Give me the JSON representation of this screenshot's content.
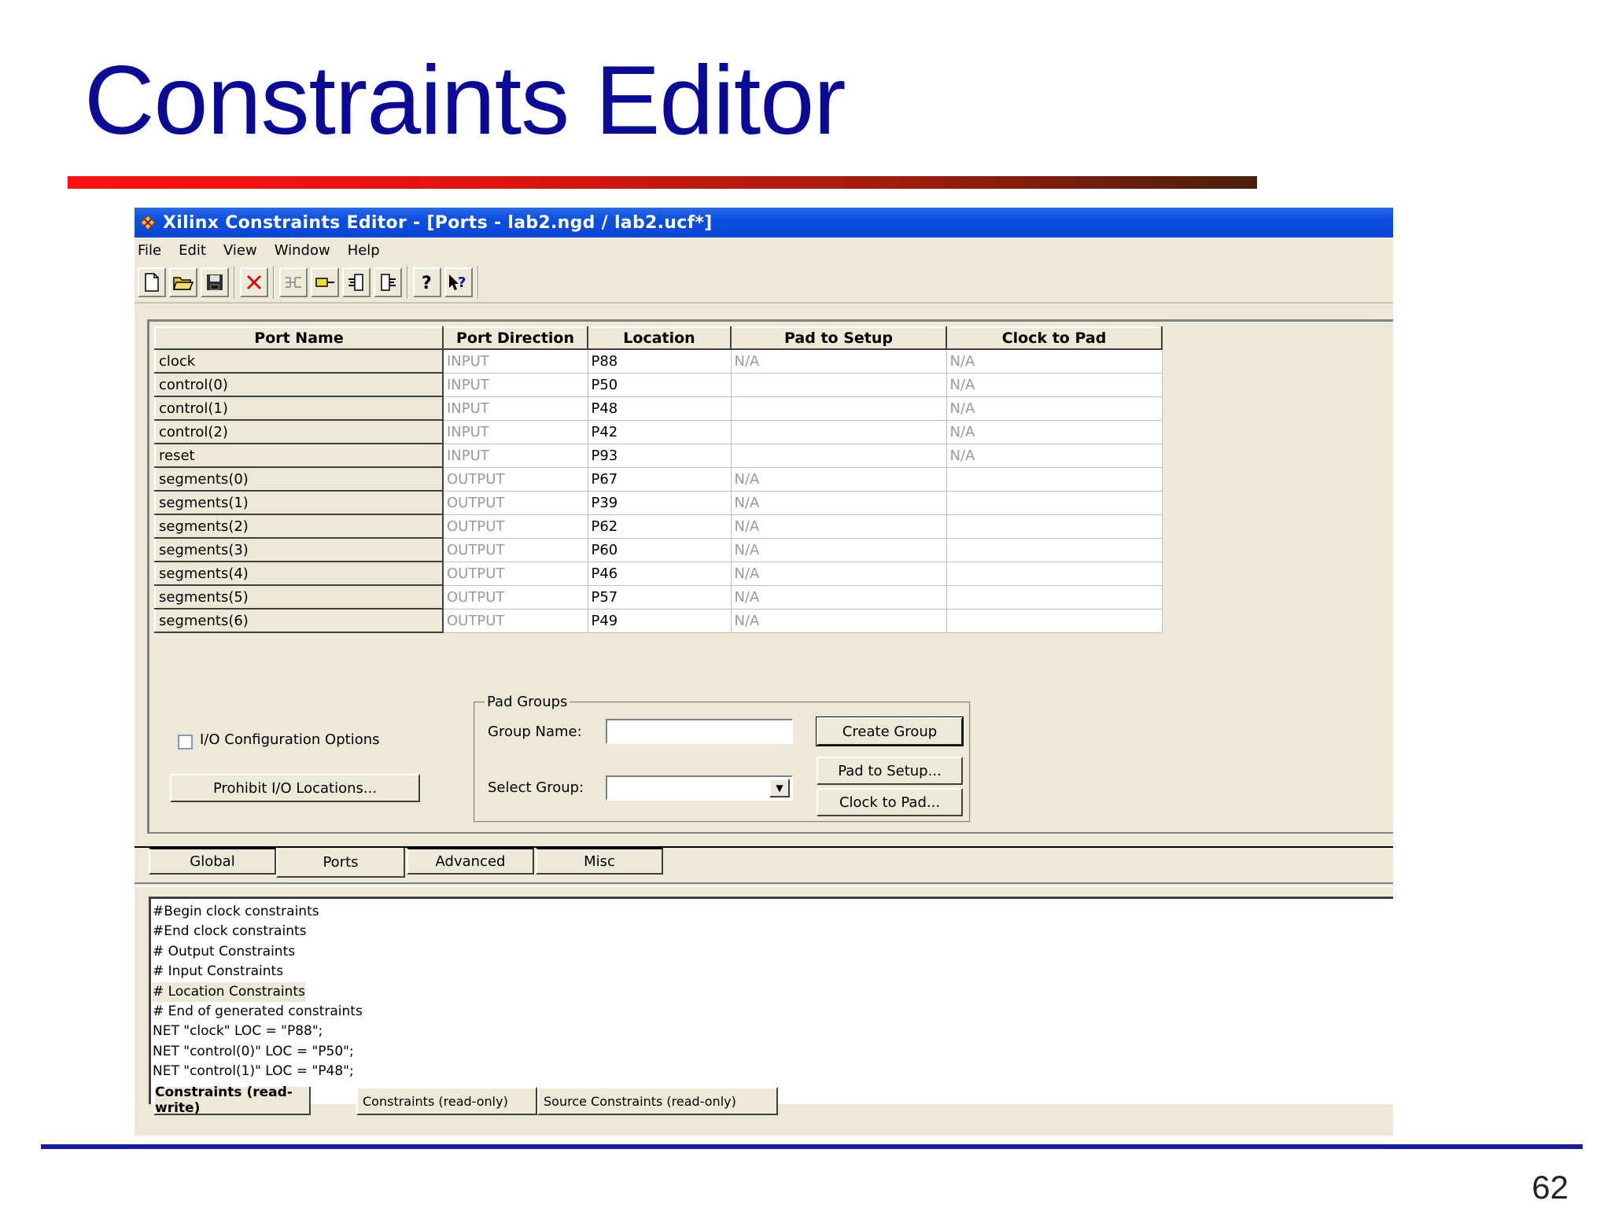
{
  "slide": {
    "title": "Constraints Editor",
    "page_number": "62"
  },
  "window": {
    "title": "Xilinx Constraints Editor - [Ports - lab2.ngd / lab2.ucf*]"
  },
  "menu": [
    "File",
    "Edit",
    "View",
    "Window",
    "Help"
  ],
  "ports_table": {
    "headers": [
      "Port Name",
      "Port Direction",
      "Location",
      "Pad to Setup",
      "Clock to Pad"
    ],
    "rows": [
      {
        "name": "clock",
        "direction": "INPUT",
        "location": "P88",
        "pad_to_setup": "N/A",
        "clock_to_pad": "N/A"
      },
      {
        "name": "control(0)",
        "direction": "INPUT",
        "location": "P50",
        "pad_to_setup": "",
        "clock_to_pad": "N/A"
      },
      {
        "name": "control(1)",
        "direction": "INPUT",
        "location": "P48",
        "pad_to_setup": "",
        "clock_to_pad": "N/A"
      },
      {
        "name": "control(2)",
        "direction": "INPUT",
        "location": "P42",
        "pad_to_setup": "",
        "clock_to_pad": "N/A"
      },
      {
        "name": "reset",
        "direction": "INPUT",
        "location": "P93",
        "pad_to_setup": "",
        "clock_to_pad": "N/A"
      },
      {
        "name": "segments(0)",
        "direction": "OUTPUT",
        "location": "P67",
        "pad_to_setup": "N/A",
        "clock_to_pad": ""
      },
      {
        "name": "segments(1)",
        "direction": "OUTPUT",
        "location": "P39",
        "pad_to_setup": "N/A",
        "clock_to_pad": ""
      },
      {
        "name": "segments(2)",
        "direction": "OUTPUT",
        "location": "P62",
        "pad_to_setup": "N/A",
        "clock_to_pad": ""
      },
      {
        "name": "segments(3)",
        "direction": "OUTPUT",
        "location": "P60",
        "pad_to_setup": "N/A",
        "clock_to_pad": ""
      },
      {
        "name": "segments(4)",
        "direction": "OUTPUT",
        "location": "P46",
        "pad_to_setup": "N/A",
        "clock_to_pad": ""
      },
      {
        "name": "segments(5)",
        "direction": "OUTPUT",
        "location": "P57",
        "pad_to_setup": "N/A",
        "clock_to_pad": ""
      },
      {
        "name": "segments(6)",
        "direction": "OUTPUT",
        "location": "P49",
        "pad_to_setup": "N/A",
        "clock_to_pad": ""
      }
    ]
  },
  "options": {
    "io_config_label": "I/O Configuration Options",
    "io_config_checked": false,
    "prohibit_button": "Prohibit I/O Locations..."
  },
  "pad_groups": {
    "legend": "Pad Groups",
    "group_name_label": "Group Name:",
    "group_name_value": "",
    "select_group_label": "Select Group:",
    "select_group_value": "",
    "create_group_button": "Create Group",
    "pad_to_setup_button": "Pad to Setup...",
    "clock_to_pad_button": "Clock to Pad..."
  },
  "tabs": {
    "items": [
      "Global",
      "Ports",
      "Advanced",
      "Misc"
    ],
    "active": "Ports"
  },
  "constraints_text": {
    "lines": [
      "#Begin clock constraints",
      "#End clock constraints",
      "# Output Constraints",
      "# Input Constraints",
      "# Location Constraints",
      "# End of generated constraints",
      "NET \"clock\" LOC = \"P88\";",
      "NET \"control(0)\" LOC = \"P50\";",
      "NET \"control(1)\" LOC = \"P48\";"
    ],
    "highlighted_line": 4
  },
  "bottom_tabs": {
    "items": [
      "Constraints (read-write)",
      "Constraints (read-only)",
      "Source Constraints (read-only)"
    ],
    "active": "Constraints (read-write)"
  },
  "colors": {
    "title_blue": "#0a0a96",
    "titlebar_blue": "#0a4fe0",
    "window_bg": "#ece9d8",
    "dim_text": "#9a9a9a"
  },
  "icons": [
    "app-icon",
    "new-file-icon",
    "open-folder-icon",
    "save-icon",
    "delete-icon",
    "group-icon",
    "pad-icon",
    "pin-left-icon",
    "pin-right-icon",
    "help-icon",
    "context-help-icon"
  ]
}
